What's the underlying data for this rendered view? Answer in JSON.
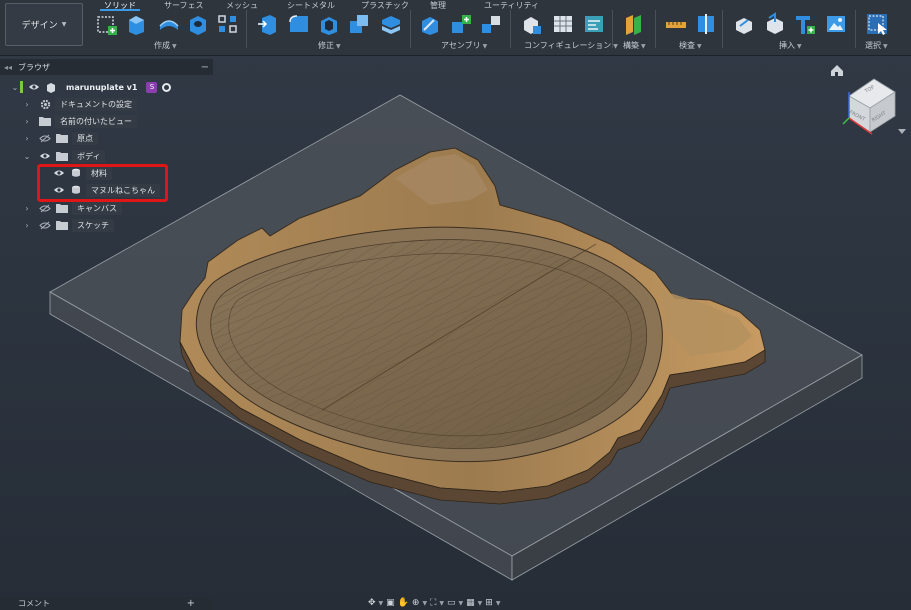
{
  "toolbar": {
    "workspace": "デザイン",
    "tabs": [
      {
        "label": "ソリッド",
        "active": true
      },
      {
        "label": "サーフェス"
      },
      {
        "label": "メッシュ"
      },
      {
        "label": "シートメタル"
      },
      {
        "label": "プラスチック"
      },
      {
        "label": "管理"
      },
      {
        "label": "ユーティリティ"
      }
    ],
    "groups": [
      "作成",
      "修正",
      "アセンブリ",
      "コンフィギュレーション",
      "構築",
      "検査",
      "挿入",
      "選択"
    ]
  },
  "browser": {
    "title": "ブラウザ",
    "root": "marunuplate v1",
    "items": [
      {
        "label": "ドキュメントの設定",
        "icon": "gear-icon"
      },
      {
        "label": "名前の付いたビュー",
        "icon": "folder-icon"
      },
      {
        "label": "原点",
        "icon": "folder-icon"
      },
      {
        "label": "ボディ",
        "icon": "folder-icon"
      },
      {
        "label": "材料",
        "icon": "body-icon"
      },
      {
        "label": "マヌルねこちゃん",
        "icon": "body-icon"
      },
      {
        "label": "キャンバス",
        "icon": "folder-icon"
      },
      {
        "label": "スケッチ",
        "icon": "folder-icon"
      }
    ]
  },
  "viewcube": {
    "top": "TOP",
    "front": "FRONT",
    "right": "RIGHT"
  },
  "comments": {
    "label": "コメント"
  },
  "colors": {
    "accent": "#3c9ae6",
    "highlight": "#e01515",
    "wood": "#8a7458"
  }
}
